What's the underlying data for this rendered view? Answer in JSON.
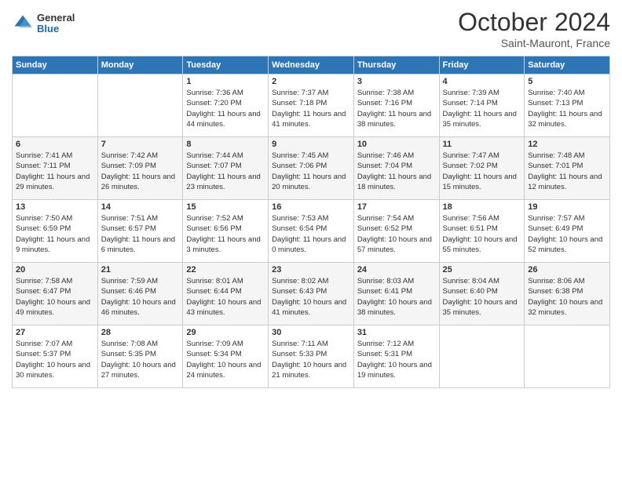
{
  "header": {
    "logo": {
      "general": "General",
      "blue": "Blue"
    },
    "title": "October 2024",
    "location": "Saint-Mauront, France"
  },
  "days_header": [
    "Sunday",
    "Monday",
    "Tuesday",
    "Wednesday",
    "Thursday",
    "Friday",
    "Saturday"
  ],
  "weeks": [
    [
      {
        "num": "",
        "sunrise": "",
        "sunset": "",
        "daylight": ""
      },
      {
        "num": "",
        "sunrise": "",
        "sunset": "",
        "daylight": ""
      },
      {
        "num": "1",
        "sunrise": "Sunrise: 7:36 AM",
        "sunset": "Sunset: 7:20 PM",
        "daylight": "Daylight: 11 hours and 44 minutes."
      },
      {
        "num": "2",
        "sunrise": "Sunrise: 7:37 AM",
        "sunset": "Sunset: 7:18 PM",
        "daylight": "Daylight: 11 hours and 41 minutes."
      },
      {
        "num": "3",
        "sunrise": "Sunrise: 7:38 AM",
        "sunset": "Sunset: 7:16 PM",
        "daylight": "Daylight: 11 hours and 38 minutes."
      },
      {
        "num": "4",
        "sunrise": "Sunrise: 7:39 AM",
        "sunset": "Sunset: 7:14 PM",
        "daylight": "Daylight: 11 hours and 35 minutes."
      },
      {
        "num": "5",
        "sunrise": "Sunrise: 7:40 AM",
        "sunset": "Sunset: 7:13 PM",
        "daylight": "Daylight: 11 hours and 32 minutes."
      }
    ],
    [
      {
        "num": "6",
        "sunrise": "Sunrise: 7:41 AM",
        "sunset": "Sunset: 7:11 PM",
        "daylight": "Daylight: 11 hours and 29 minutes."
      },
      {
        "num": "7",
        "sunrise": "Sunrise: 7:42 AM",
        "sunset": "Sunset: 7:09 PM",
        "daylight": "Daylight: 11 hours and 26 minutes."
      },
      {
        "num": "8",
        "sunrise": "Sunrise: 7:44 AM",
        "sunset": "Sunset: 7:07 PM",
        "daylight": "Daylight: 11 hours and 23 minutes."
      },
      {
        "num": "9",
        "sunrise": "Sunrise: 7:45 AM",
        "sunset": "Sunset: 7:06 PM",
        "daylight": "Daylight: 11 hours and 20 minutes."
      },
      {
        "num": "10",
        "sunrise": "Sunrise: 7:46 AM",
        "sunset": "Sunset: 7:04 PM",
        "daylight": "Daylight: 11 hours and 18 minutes."
      },
      {
        "num": "11",
        "sunrise": "Sunrise: 7:47 AM",
        "sunset": "Sunset: 7:02 PM",
        "daylight": "Daylight: 11 hours and 15 minutes."
      },
      {
        "num": "12",
        "sunrise": "Sunrise: 7:48 AM",
        "sunset": "Sunset: 7:01 PM",
        "daylight": "Daylight: 11 hours and 12 minutes."
      }
    ],
    [
      {
        "num": "13",
        "sunrise": "Sunrise: 7:50 AM",
        "sunset": "Sunset: 6:59 PM",
        "daylight": "Daylight: 11 hours and 9 minutes."
      },
      {
        "num": "14",
        "sunrise": "Sunrise: 7:51 AM",
        "sunset": "Sunset: 6:57 PM",
        "daylight": "Daylight: 11 hours and 6 minutes."
      },
      {
        "num": "15",
        "sunrise": "Sunrise: 7:52 AM",
        "sunset": "Sunset: 6:56 PM",
        "daylight": "Daylight: 11 hours and 3 minutes."
      },
      {
        "num": "16",
        "sunrise": "Sunrise: 7:53 AM",
        "sunset": "Sunset: 6:54 PM",
        "daylight": "Daylight: 11 hours and 0 minutes."
      },
      {
        "num": "17",
        "sunrise": "Sunrise: 7:54 AM",
        "sunset": "Sunset: 6:52 PM",
        "daylight": "Daylight: 10 hours and 57 minutes."
      },
      {
        "num": "18",
        "sunrise": "Sunrise: 7:56 AM",
        "sunset": "Sunset: 6:51 PM",
        "daylight": "Daylight: 10 hours and 55 minutes."
      },
      {
        "num": "19",
        "sunrise": "Sunrise: 7:57 AM",
        "sunset": "Sunset: 6:49 PM",
        "daylight": "Daylight: 10 hours and 52 minutes."
      }
    ],
    [
      {
        "num": "20",
        "sunrise": "Sunrise: 7:58 AM",
        "sunset": "Sunset: 6:47 PM",
        "daylight": "Daylight: 10 hours and 49 minutes."
      },
      {
        "num": "21",
        "sunrise": "Sunrise: 7:59 AM",
        "sunset": "Sunset: 6:46 PM",
        "daylight": "Daylight: 10 hours and 46 minutes."
      },
      {
        "num": "22",
        "sunrise": "Sunrise: 8:01 AM",
        "sunset": "Sunset: 6:44 PM",
        "daylight": "Daylight: 10 hours and 43 minutes."
      },
      {
        "num": "23",
        "sunrise": "Sunrise: 8:02 AM",
        "sunset": "Sunset: 6:43 PM",
        "daylight": "Daylight: 10 hours and 41 minutes."
      },
      {
        "num": "24",
        "sunrise": "Sunrise: 8:03 AM",
        "sunset": "Sunset: 6:41 PM",
        "daylight": "Daylight: 10 hours and 38 minutes."
      },
      {
        "num": "25",
        "sunrise": "Sunrise: 8:04 AM",
        "sunset": "Sunset: 6:40 PM",
        "daylight": "Daylight: 10 hours and 35 minutes."
      },
      {
        "num": "26",
        "sunrise": "Sunrise: 8:06 AM",
        "sunset": "Sunset: 6:38 PM",
        "daylight": "Daylight: 10 hours and 32 minutes."
      }
    ],
    [
      {
        "num": "27",
        "sunrise": "Sunrise: 7:07 AM",
        "sunset": "Sunset: 5:37 PM",
        "daylight": "Daylight: 10 hours and 30 minutes."
      },
      {
        "num": "28",
        "sunrise": "Sunrise: 7:08 AM",
        "sunset": "Sunset: 5:35 PM",
        "daylight": "Daylight: 10 hours and 27 minutes."
      },
      {
        "num": "29",
        "sunrise": "Sunrise: 7:09 AM",
        "sunset": "Sunset: 5:34 PM",
        "daylight": "Daylight: 10 hours and 24 minutes."
      },
      {
        "num": "30",
        "sunrise": "Sunrise: 7:11 AM",
        "sunset": "Sunset: 5:33 PM",
        "daylight": "Daylight: 10 hours and 21 minutes."
      },
      {
        "num": "31",
        "sunrise": "Sunrise: 7:12 AM",
        "sunset": "Sunset: 5:31 PM",
        "daylight": "Daylight: 10 hours and 19 minutes."
      },
      {
        "num": "",
        "sunrise": "",
        "sunset": "",
        "daylight": ""
      },
      {
        "num": "",
        "sunrise": "",
        "sunset": "",
        "daylight": ""
      }
    ]
  ]
}
